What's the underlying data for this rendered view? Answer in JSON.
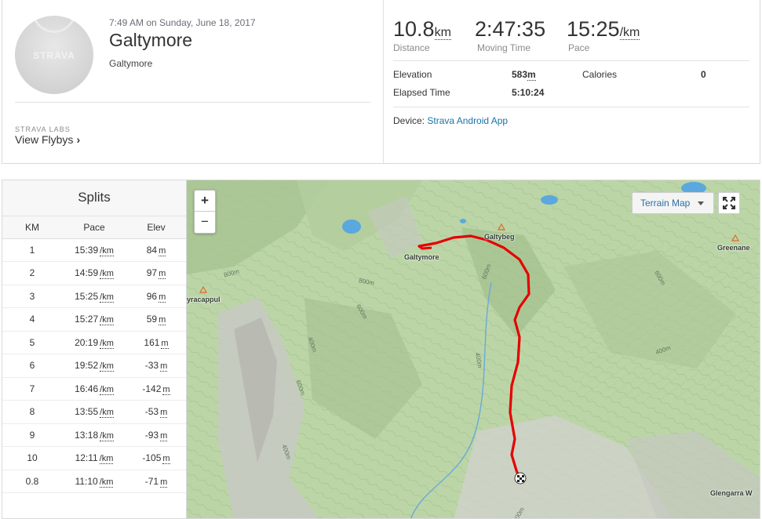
{
  "activity": {
    "avatar_logo": "STRAVA",
    "date": "7:49 AM on Sunday, June 18, 2017",
    "title": "Galtymore",
    "description": "Galtymore",
    "labs_tag": "STRAVA LABS",
    "flyby_label": "View Flybys"
  },
  "stats": {
    "distance": {
      "value": "10.8",
      "unit": "km",
      "label": "Distance"
    },
    "moving_time": {
      "value": "2:47:35",
      "label": "Moving Time"
    },
    "pace": {
      "value": "15:25",
      "unit": "/km",
      "label": "Pace"
    },
    "elevation_label": "Elevation",
    "elevation_value": "583",
    "elevation_unit": "m",
    "calories_label": "Calories",
    "calories_value": "0",
    "elapsed_label": "Elapsed Time",
    "elapsed_value": "5:10:24",
    "device_label": "Device:",
    "device_value": "Strava Android App"
  },
  "splits": {
    "title": "Splits",
    "headers": [
      "KM",
      "Pace",
      "Elev"
    ],
    "pace_unit": "/km",
    "elev_unit": "m",
    "rows": [
      {
        "km": "1",
        "pace": "15:39",
        "elev": "84"
      },
      {
        "km": "2",
        "pace": "14:59",
        "elev": "97"
      },
      {
        "km": "3",
        "pace": "15:25",
        "elev": "96"
      },
      {
        "km": "4",
        "pace": "15:27",
        "elev": "59"
      },
      {
        "km": "5",
        "pace": "20:19",
        "elev": "161"
      },
      {
        "km": "6",
        "pace": "19:52",
        "elev": "-33"
      },
      {
        "km": "7",
        "pace": "16:46",
        "elev": "-142"
      },
      {
        "km": "8",
        "pace": "13:55",
        "elev": "-53"
      },
      {
        "km": "9",
        "pace": "13:18",
        "elev": "-93"
      },
      {
        "km": "10",
        "pace": "12:11",
        "elev": "-105"
      },
      {
        "km": "0.8",
        "pace": "11:10",
        "elev": "-71"
      }
    ]
  },
  "map": {
    "zoom_in": "+",
    "zoom_out": "−",
    "layer_select": "Terrain Map",
    "places": [
      "Galtymore",
      "Galtybeg",
      "Greenane",
      "yracappul",
      "Glengarra W"
    ],
    "contours": [
      "800m",
      "800m",
      "600m",
      "600m",
      "400m",
      "600m",
      "400m",
      "400m",
      "800m",
      "600m",
      "400m",
      "400m"
    ],
    "route_color": "#e60000",
    "terrain_color": "#b9d3a4",
    "water_color": "#5aa8de"
  }
}
